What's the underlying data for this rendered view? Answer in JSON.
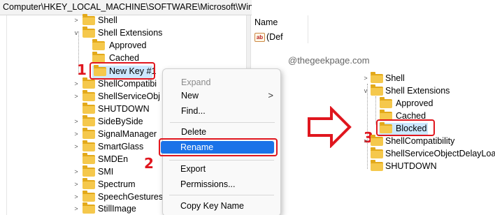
{
  "address_bar": {
    "path": "Computer\\HKEY_LOCAL_MACHINE\\SOFTWARE\\Microsoft\\Windows\\Curre"
  },
  "left_tree": {
    "items": [
      {
        "label": "Shell",
        "expander": ">"
      },
      {
        "label": "Shell Extensions",
        "expander": "v"
      },
      {
        "label": "Approved",
        "expander": ""
      },
      {
        "label": "Cached",
        "expander": ""
      },
      {
        "label": "New Key #1",
        "expander": ""
      },
      {
        "label": "ShellCompatibi",
        "expander": ">"
      },
      {
        "label": "ShellServiceObj",
        "expander": ">"
      },
      {
        "label": "SHUTDOWN",
        "expander": ""
      },
      {
        "label": "SideBySide",
        "expander": ">"
      },
      {
        "label": "SignalManager",
        "expander": ">"
      },
      {
        "label": "SmartGlass",
        "expander": ">"
      },
      {
        "label": "SMDEn",
        "expander": ""
      },
      {
        "label": "SMI",
        "expander": ">"
      },
      {
        "label": "Spectrum",
        "expander": ">"
      },
      {
        "label": "SpeechGestures",
        "expander": ">"
      },
      {
        "label": "StillImage",
        "expander": ">"
      }
    ]
  },
  "context_menu": {
    "items": [
      {
        "label": "Expand",
        "disabled": true
      },
      {
        "label": "New",
        "submenu": ">"
      },
      {
        "label": "Find..."
      },
      {
        "label": "Delete"
      },
      {
        "label": "Rename"
      },
      {
        "label": "Export"
      },
      {
        "label": "Permissions..."
      },
      {
        "label": "Copy Key Name"
      }
    ]
  },
  "right_panel": {
    "column_name": "Name",
    "default_value": "(Def",
    "ab_icon": "ab",
    "watermark": "@thegeekpage.com"
  },
  "right_tree": {
    "items": [
      {
        "label": "Shell",
        "expander": ">"
      },
      {
        "label": "Shell Extensions",
        "expander": "v"
      },
      {
        "label": "Approved",
        "expander": ""
      },
      {
        "label": "Cached",
        "expander": ""
      },
      {
        "label": "Blocked",
        "expander": ""
      },
      {
        "label": "ShellCompatibility",
        "expander": ">"
      },
      {
        "label": "ShellServiceObjectDelayLoad",
        "expander": ""
      },
      {
        "label": "SHUTDOWN",
        "expander": ""
      }
    ]
  },
  "step_badges": {
    "one": "1",
    "two": "2",
    "three": "3"
  },
  "colors": {
    "highlight": "#e0161e",
    "selection": "#1a73e8",
    "folder": "#f5c84c"
  }
}
